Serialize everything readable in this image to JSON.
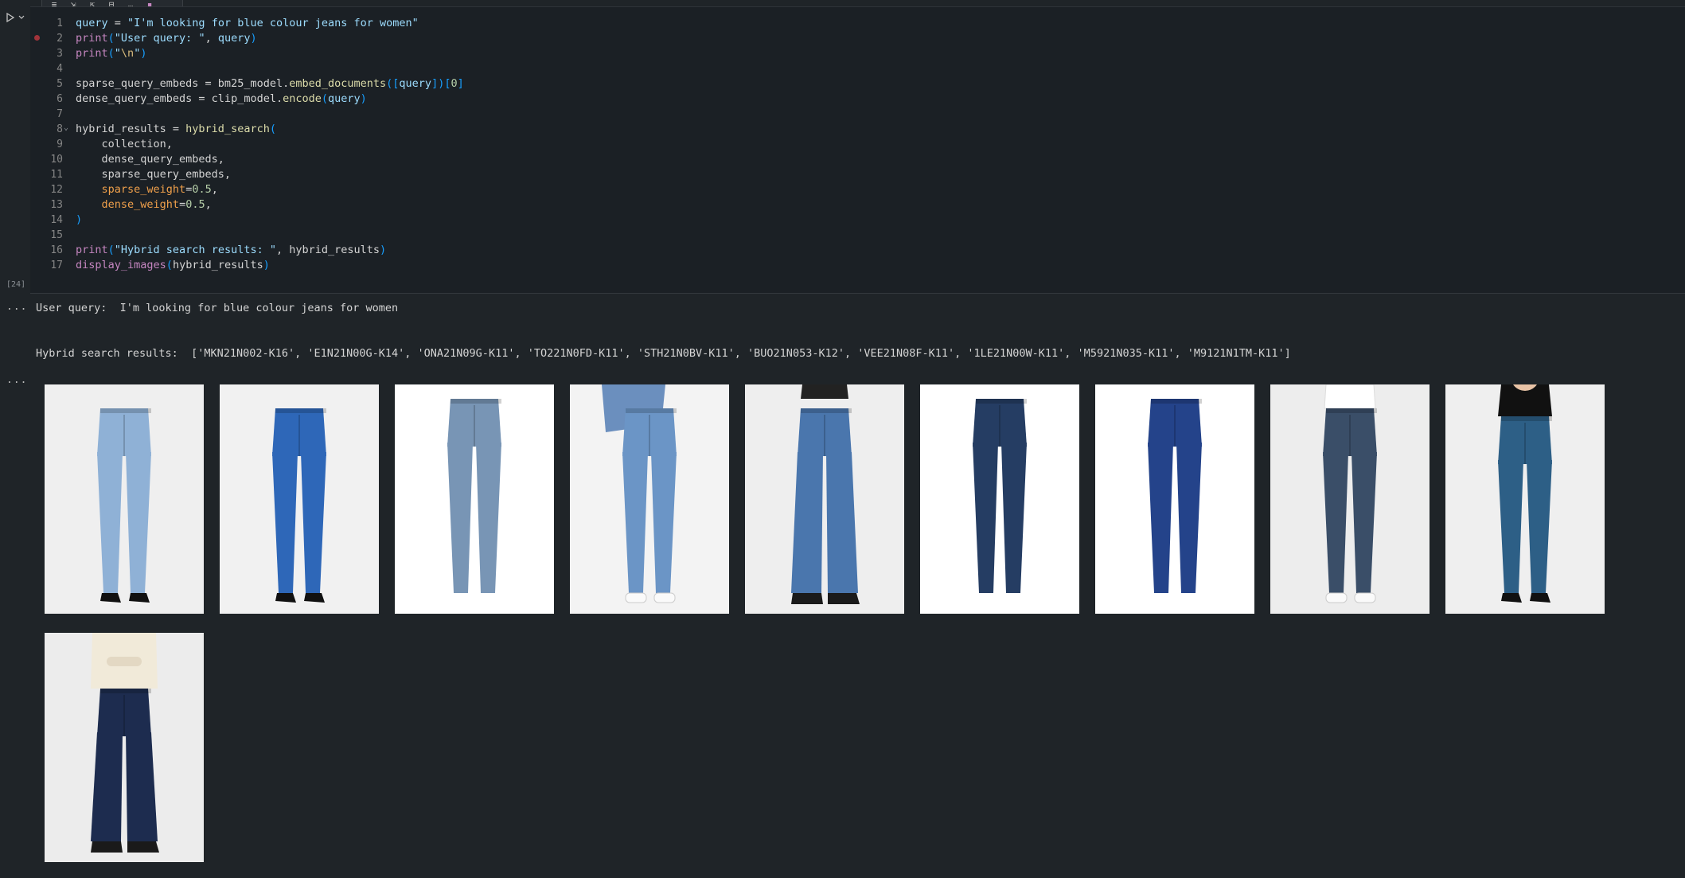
{
  "toolbar": {
    "icons": [
      "execute-above-icon",
      "execute-below-icon",
      "execute-cell-below-icon",
      "split-cell-icon",
      "more-icon",
      "delete-icon"
    ]
  },
  "cell": {
    "execution_count": "[24]",
    "line_numbers": [
      "1",
      "2",
      "3",
      "4",
      "5",
      "6",
      "7",
      "8",
      "9",
      "10",
      "11",
      "12",
      "13",
      "14",
      "15",
      "16",
      "17"
    ],
    "code_lines": [
      "query = \"I'm looking for blue colour jeans for women\"",
      "print(\"User query: \", query)",
      "print(\"\\n\")",
      "",
      "sparse_query_embeds = bm25_model.embed_documents([query])[0]",
      "dense_query_embeds = clip_model.encode(query)",
      "",
      "hybrid_results = hybrid_search(",
      "    collection,",
      "    dense_query_embeds,",
      "    sparse_query_embeds,",
      "    sparse_weight=0.5,",
      "    dense_weight=0.5,",
      ")",
      "",
      "print(\"Hybrid search results: \", hybrid_results)",
      "display_images(hybrid_results)"
    ]
  },
  "output": {
    "marker_1": "...",
    "marker_2": "...",
    "user_query_line": "User query:  I'm looking for blue colour jeans for women",
    "results_line": "Hybrid search results:  ['MKN21N002-K16', 'E1N21N00G-K14', 'ONA21N09G-K11', 'TO221N0FD-K11', 'STH21N0BV-K11', 'BUO21N053-K12', 'VEE21N08F-K11', '1LE21N00W-K11', 'M5921N035-K11', 'M9121N1TM-K11']",
    "images": [
      {
        "product_id": "MKN21N002-K16",
        "denim": "#8fb1d6",
        "bg": "#efefef",
        "style": "heels-light"
      },
      {
        "product_id": "E1N21N00G-K14",
        "denim": "#2e67b8",
        "bg": "#f1f1f1",
        "style": "heels-bright"
      },
      {
        "product_id": "ONA21N09G-K11",
        "denim": "#7895b5",
        "bg": "#ffffff",
        "style": "flat-product"
      },
      {
        "product_id": "TO221N0FD-K11",
        "denim": "#6b95c6",
        "bg": "#f3f3f3",
        "style": "sneaker-jacket"
      },
      {
        "product_id": "STH21N0BV-K11",
        "denim": "#4a76ad",
        "bg": "#eeeeee",
        "style": "boots-flare"
      },
      {
        "product_id": "BUO21N053-K12",
        "denim": "#253d63",
        "bg": "#ffffff",
        "style": "flat-dark"
      },
      {
        "product_id": "VEE21N08F-K11",
        "denim": "#24438a",
        "bg": "#ffffff",
        "style": "flat-navy"
      },
      {
        "product_id": "1LE21N00W-K11",
        "denim": "#3a4e68",
        "bg": "#ededed",
        "style": "sneaker-grey"
      },
      {
        "product_id": "M5921N035-K11",
        "denim": "#2d5f86",
        "bg": "#efefef",
        "style": "heels-teal"
      },
      {
        "product_id": "M9121N1TM-K11",
        "denim": "#1d2c4f",
        "bg": "#ececec",
        "style": "wide-leg"
      }
    ]
  }
}
